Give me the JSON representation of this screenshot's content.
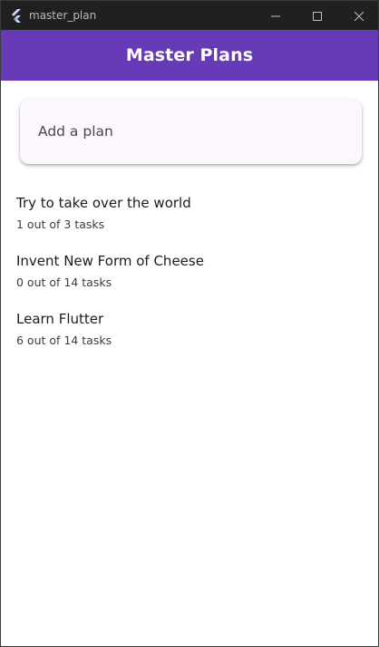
{
  "window": {
    "title": "master_plan",
    "icons": {
      "app": "flutter-logo-icon",
      "minimize": "minimize-icon",
      "maximize": "maximize-icon",
      "close": "close-icon"
    }
  },
  "appbar": {
    "title": "Master Plans",
    "color": "#673ab7"
  },
  "add_plan": {
    "placeholder": "Add a plan",
    "value": ""
  },
  "plans": [
    {
      "name": "Try to take over the world",
      "progress": "1 out of 3 tasks"
    },
    {
      "name": "Invent New Form of Cheese",
      "progress": "0 out of 14 tasks"
    },
    {
      "name": "Learn Flutter",
      "progress": "6 out of 14 tasks"
    }
  ]
}
